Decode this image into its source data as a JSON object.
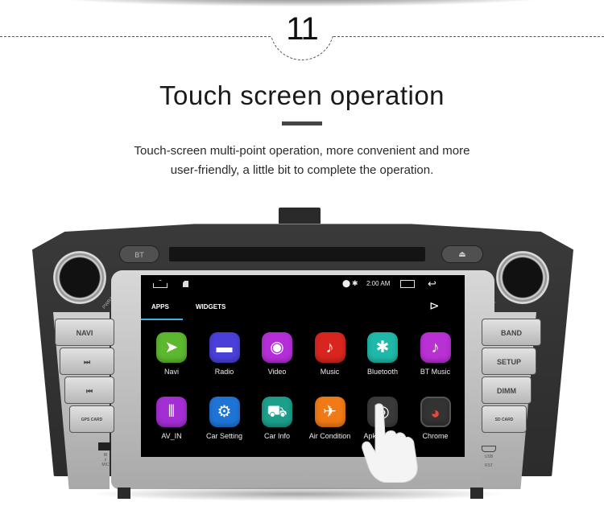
{
  "header": {
    "step_number": "11",
    "title": "Touch screen operation",
    "description_line1": "Touch-screen multi-point operation, more convenient and more",
    "description_line2": "user-friendly, a little bit to complete the operation."
  },
  "device": {
    "top_buttons": {
      "bt": "BT",
      "eject": "⏏"
    },
    "knob_labels": {
      "left": "PWR/VOL",
      "right": "SEEK"
    },
    "left_buttons": [
      "NAVI",
      "⏭",
      "⏮",
      "GPS CARD"
    ],
    "left_port_label": "IR\n♯\nMIC",
    "right_buttons": [
      "BAND",
      "SETUP",
      "DIMM",
      "SD CARD"
    ],
    "right_port_labels": [
      "USB",
      "RST"
    ]
  },
  "screen": {
    "status_bar": {
      "home_icon": "home-icon",
      "sd_icon": "sd-card-icon",
      "location_icon": "⬤",
      "bluetooth_icon": "✱",
      "time": "2:00 AM",
      "recents_icon": "recents-icon",
      "back_icon": "↩"
    },
    "tabs": [
      {
        "label": "APPS",
        "active": true
      },
      {
        "label": "WIDGETS",
        "active": false
      }
    ],
    "store_icon": "⊳",
    "accent_color": "#33b5e5",
    "apps": [
      {
        "label": "Navi",
        "icon": "navi-icon",
        "glyph": "➤",
        "color": "#5cb82f"
      },
      {
        "label": "Radio",
        "icon": "radio-icon",
        "glyph": "▬",
        "color": "#4a3fd8"
      },
      {
        "label": "Video",
        "icon": "video-icon",
        "glyph": "◉",
        "color": "#b52fd9"
      },
      {
        "label": "Music",
        "icon": "music-icon",
        "glyph": "♪",
        "color": "#d8251f"
      },
      {
        "label": "Bluetooth",
        "icon": "bluetooth-icon",
        "glyph": "✱",
        "color": "#1fb8a9"
      },
      {
        "label": "BT Music",
        "icon": "bt-music-icon",
        "glyph": "♪",
        "color": "#b930d4"
      },
      {
        "label": "AV_IN",
        "icon": "av-in-icon",
        "glyph": "⫴",
        "color": "#a32ed3"
      },
      {
        "label": "Car Setting",
        "icon": "car-setting-icon",
        "glyph": "⚙",
        "color": "#1e74d6"
      },
      {
        "label": "Car Info",
        "icon": "car-info-icon",
        "glyph": "⛟",
        "color": "#1b9f8a"
      },
      {
        "label": "Air Condition",
        "icon": "air-condition-icon",
        "glyph": "✈",
        "color": "#f07a15"
      },
      {
        "label": "ApkInstaller",
        "icon": "apk-installer-icon",
        "glyph": "◎",
        "color": "#3a3a3a"
      },
      {
        "label": "Chrome",
        "icon": "chrome-icon",
        "glyph": "◕",
        "color": "#3a3a3a"
      }
    ]
  }
}
